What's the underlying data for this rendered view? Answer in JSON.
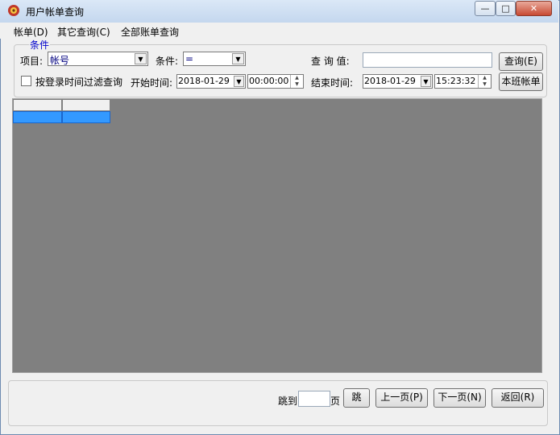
{
  "window": {
    "title": "用户帐单查询",
    "close_glyph": "✕",
    "max_glyph": "□",
    "min_glyph": "—"
  },
  "menu": [
    {
      "label": "帐单(D)"
    },
    {
      "label": "其它查询(C)"
    },
    {
      "label": "全部账单查询"
    }
  ],
  "conditions": {
    "legend": "条件",
    "item_label": "项目:",
    "item_value": "帐号",
    "cond_label": "条件:",
    "cond_value": "=",
    "query_value_label": "查 询 值:",
    "query_value": "",
    "query_button": "查询(E)",
    "shift_button": "本班帐单",
    "filter_checkbox_label": "按登录时间过滤查询",
    "filter_checked": false,
    "start_label": "开始时间:",
    "start_date": "2018-01-29",
    "start_time": "00:00:00",
    "end_label": "结束时间:",
    "end_date": "2018-01-29",
    "end_time": "15:23:32"
  },
  "pager": {
    "jump_label": "跳到",
    "page_value": "",
    "page_label": "页",
    "jump_button": "跳",
    "prev_button": "上一页(P)",
    "next_button": "下一页(N)",
    "back_button": "返回(R)"
  },
  "colors": {
    "grid_bg": "#808080",
    "selection": "#3399ff",
    "legend": "#0000cc"
  }
}
